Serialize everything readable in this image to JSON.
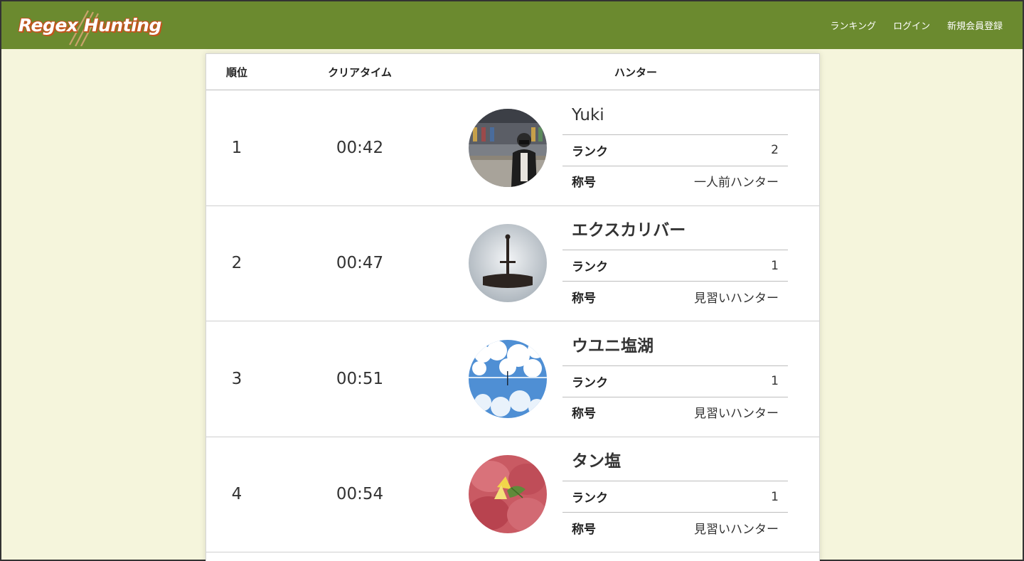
{
  "nav": {
    "logo": "Regex Hunting",
    "links": [
      "ランキング",
      "ログイン",
      "新規会員登録"
    ]
  },
  "table": {
    "headers": {
      "rank": "順位",
      "time": "クリアタイム",
      "hunter": "ハンター"
    },
    "rank_label": "ランク",
    "title_label": "称号",
    "rows": [
      {
        "rank": "1",
        "time": "00:42",
        "name": "Yuki",
        "hunter_rank": "2",
        "title": "一人前ハンター",
        "avatar": "avatar-person-icon"
      },
      {
        "rank": "2",
        "time": "00:47",
        "name": "エクスカリバー",
        "hunter_rank": "1",
        "title": "見習いハンター",
        "avatar": "avatar-sword-icon"
      },
      {
        "rank": "3",
        "time": "00:51",
        "name": "ウユニ塩湖",
        "hunter_rank": "1",
        "title": "見習いハンター",
        "avatar": "avatar-sky-icon"
      },
      {
        "rank": "4",
        "time": "00:54",
        "name": "タン塩",
        "hunter_rank": "1",
        "title": "見習いハンター",
        "avatar": "avatar-meat-icon"
      }
    ]
  },
  "colors": {
    "navbar": "#6b8a2f",
    "background": "#f5f5dc"
  }
}
